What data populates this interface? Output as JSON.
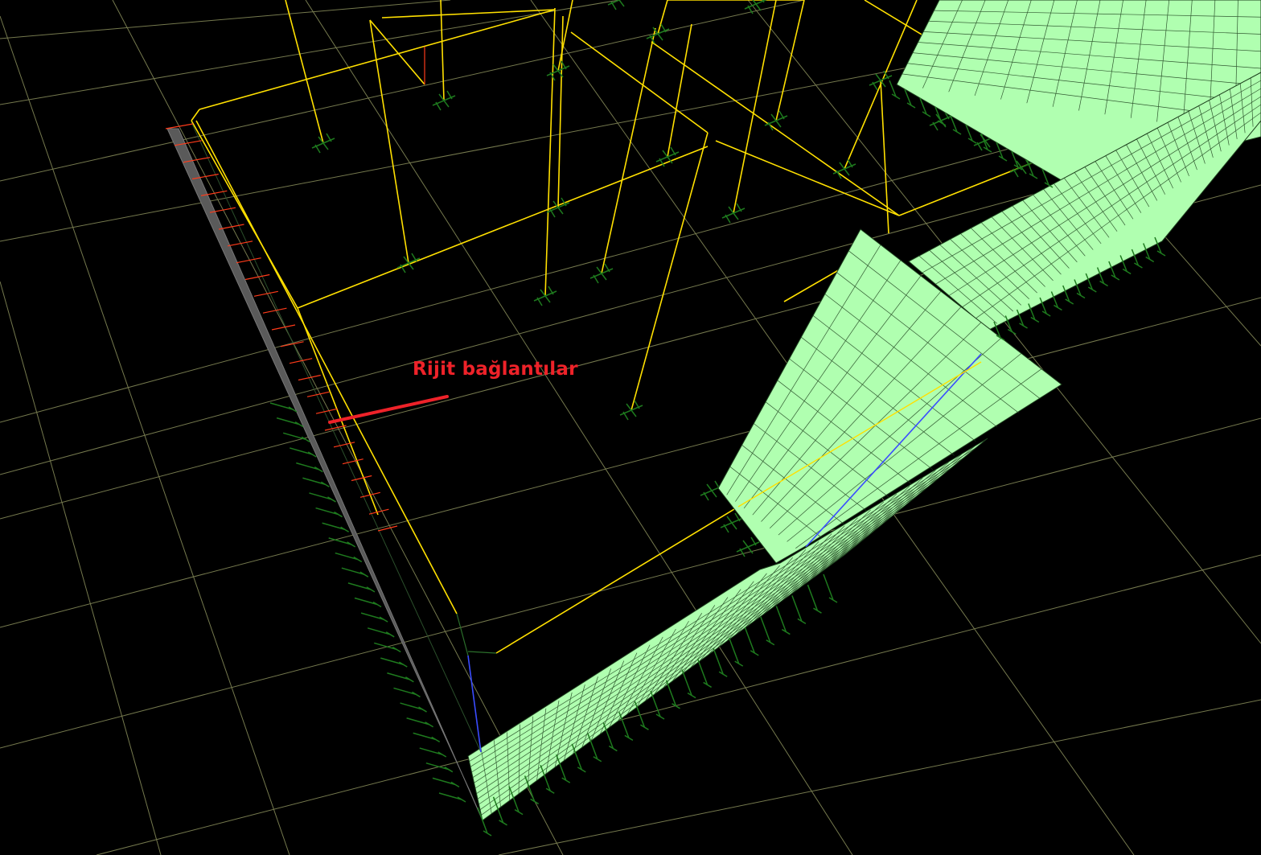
{
  "annotation": {
    "label": "Rijit bağlantılar"
  },
  "colors": {
    "background": "#000000",
    "ground_grid": "#8a8f5c",
    "frame": "#ffe000",
    "wall_fill": "#b0ffb0",
    "wall_mesh": "#1c3d1c",
    "supports": "#1e7a1e",
    "rigid_links": "#ff3b1a",
    "annotation": "#ee2229",
    "highlight_edge": "#3a4cff",
    "wall_edge_dark": "#6a6a6a"
  },
  "icons": {
    "supports": "spring-support-icon",
    "nodes": "node-support-icon",
    "arrow": "annotation-arrow-icon"
  }
}
